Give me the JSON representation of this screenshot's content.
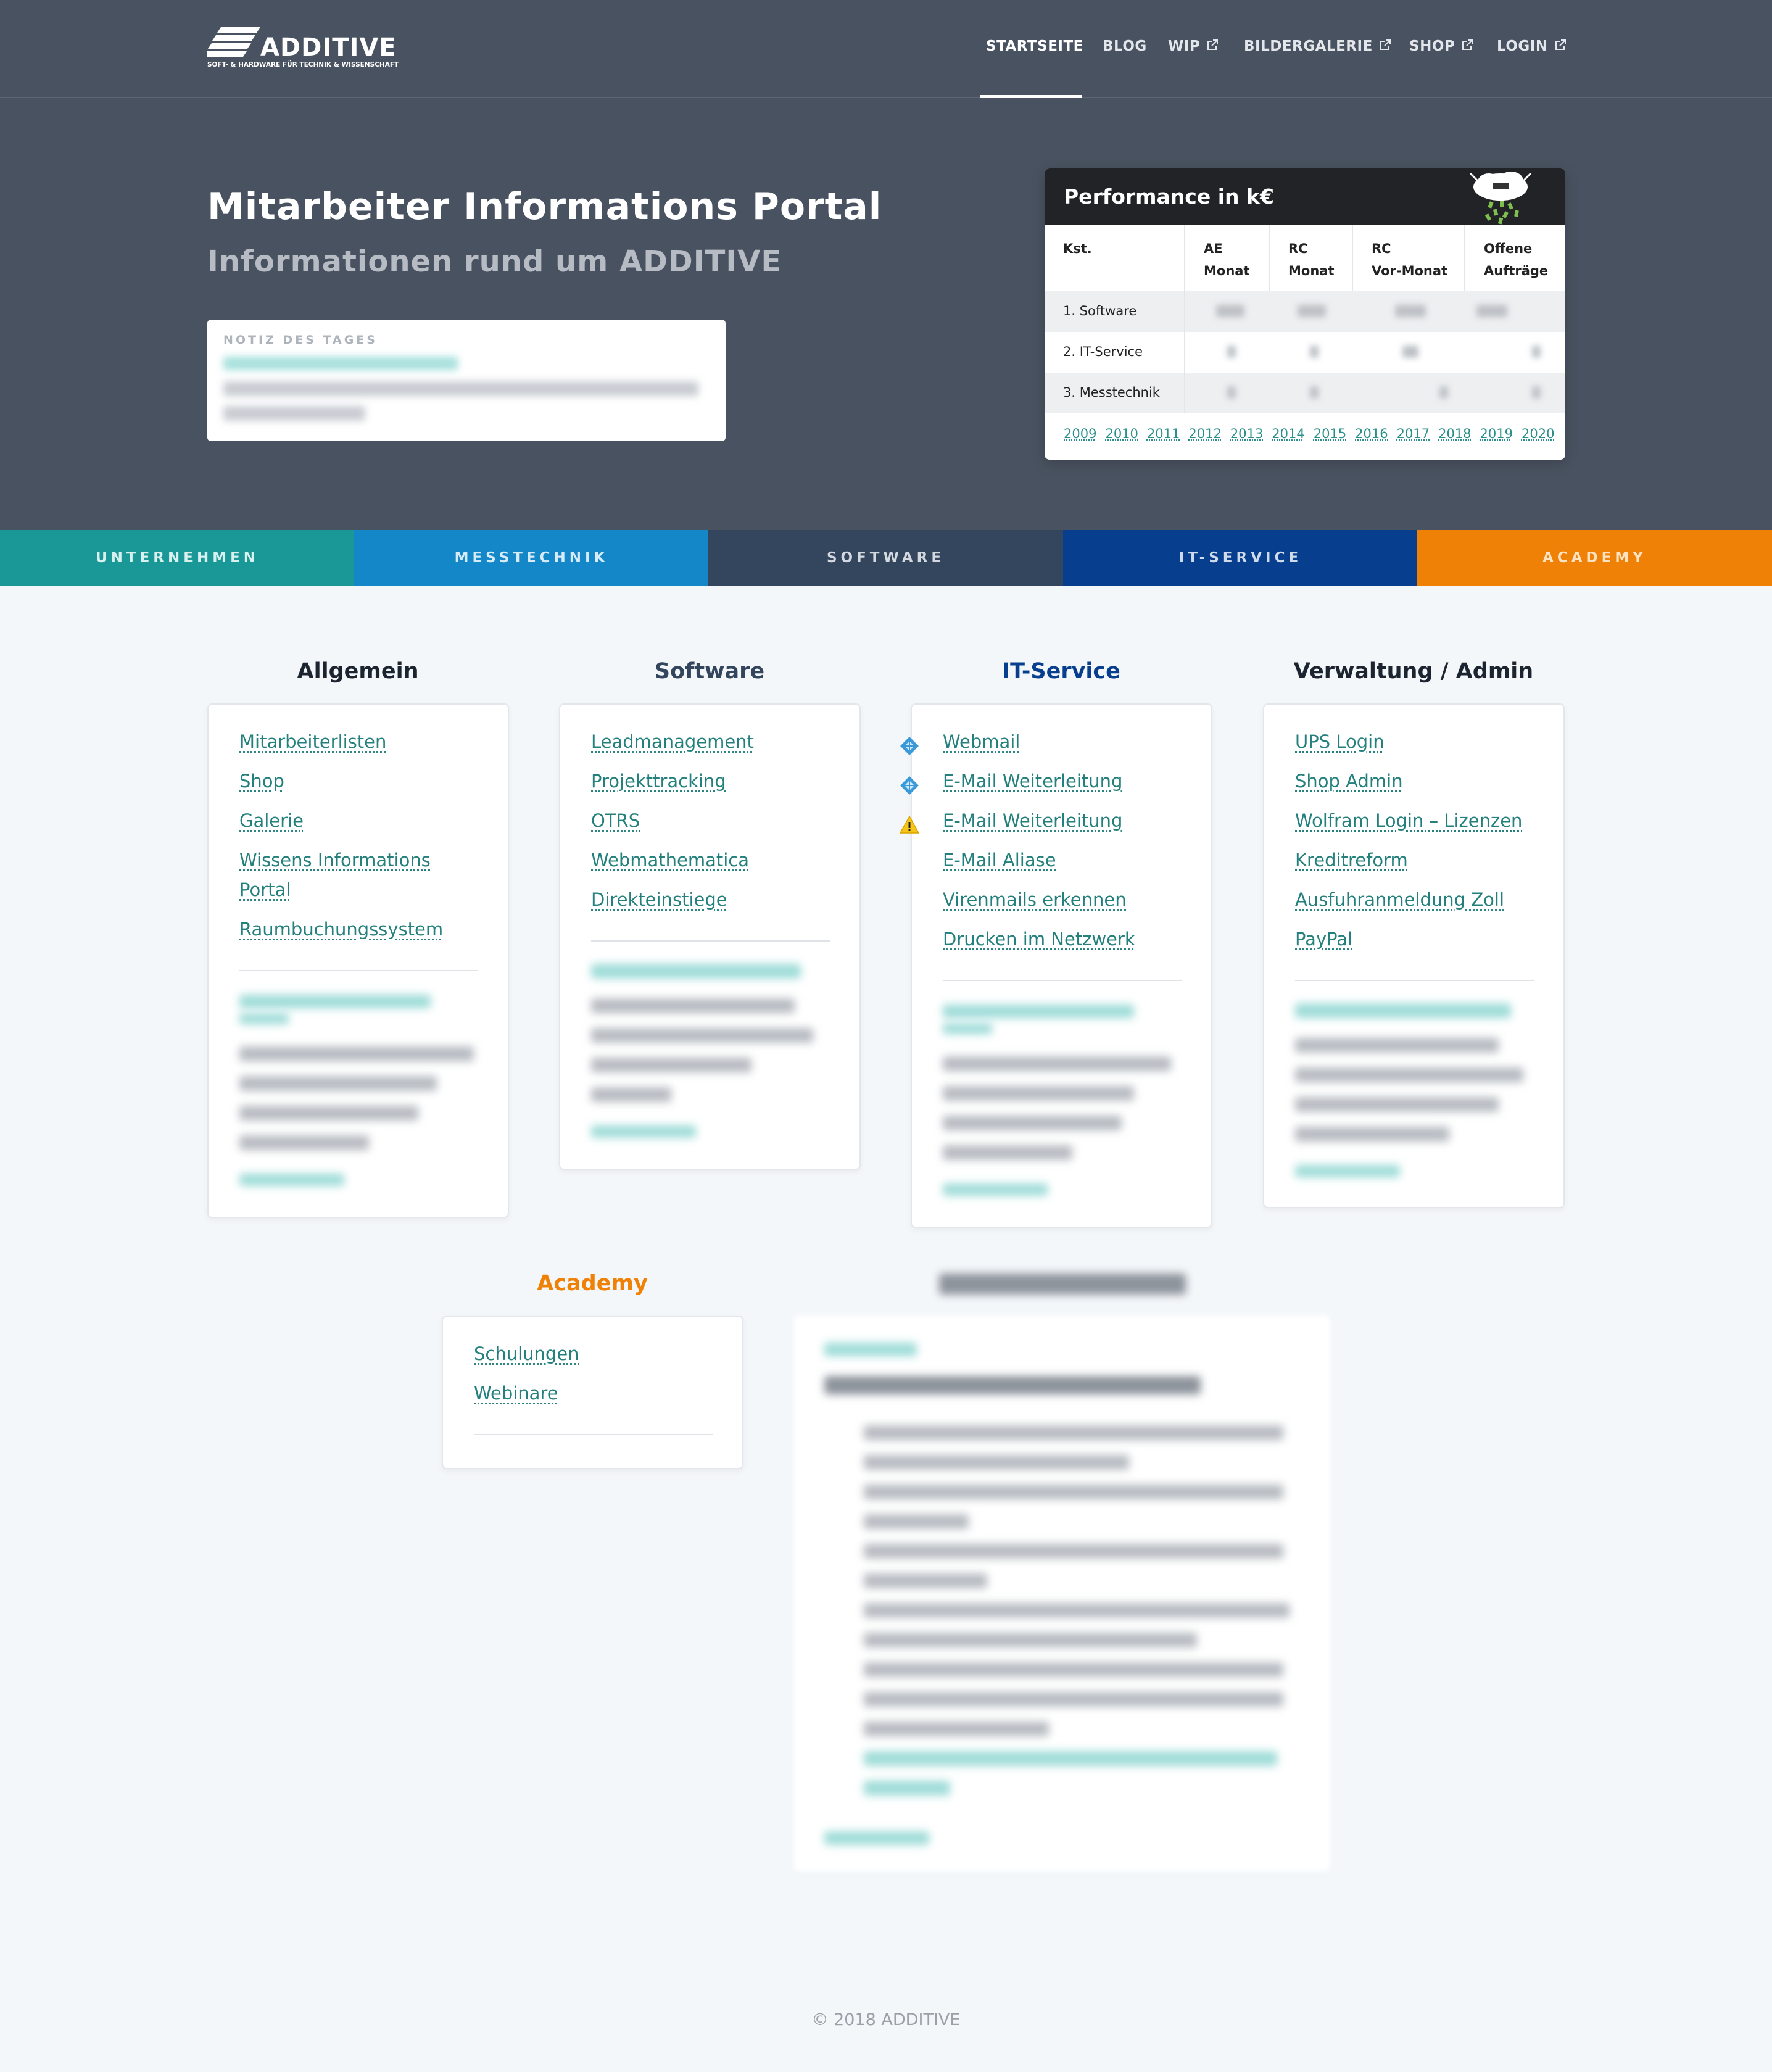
{
  "header": {
    "logo_text": "ADDITIVE",
    "logo_sub": "SOFT- & HARDWARE FÜR TECHNIK & WISSENSCHAFT",
    "nav": [
      {
        "label": "STARTSEITE",
        "external": false,
        "active": true
      },
      {
        "label": "BLOG",
        "external": false,
        "active": false
      },
      {
        "label": "WIP",
        "external": true,
        "active": false
      },
      {
        "label": "BILDERGALERIE",
        "external": true,
        "active": false
      },
      {
        "label": "SHOP",
        "external": true,
        "active": false
      },
      {
        "label": "LOGIN",
        "external": true,
        "active": false
      }
    ]
  },
  "hero": {
    "title": "Mitarbeiter Informations Portal",
    "subtitle": "Informationen rund um ADDITIVE",
    "note_heading": "NOTIZ DES TAGES"
  },
  "performance": {
    "title": "Performance in k€",
    "columns": [
      {
        "line1": "Kst.",
        "line2": ""
      },
      {
        "line1": "AE",
        "line2": "Monat"
      },
      {
        "line1": "RC",
        "line2": "Monat"
      },
      {
        "line1": "RC",
        "line2": "Vor-Monat"
      },
      {
        "line1": "Offene",
        "line2": "Aufträge"
      }
    ],
    "rows": [
      "1. Software",
      "2. IT-Service",
      "3. Messtechnik"
    ],
    "years": [
      "2009",
      "2010",
      "2011",
      "2012",
      "2013",
      "2014",
      "2015",
      "2016",
      "2017",
      "2018",
      "2019",
      "2020"
    ]
  },
  "categories": [
    {
      "label": "UNTERNEHMEN",
      "bg": "#1a9797",
      "fg": "#d8f0ee"
    },
    {
      "label": "MESSTECHNIK",
      "bg": "#1487c8",
      "fg": "#d6ebf7"
    },
    {
      "label": "SOFTWARE",
      "bg": "#34465e",
      "fg": "#d4d9e0"
    },
    {
      "label": "IT-SERVICE",
      "bg": "#073f8e",
      "fg": "#cfdaeb"
    },
    {
      "label": "ACADEMY",
      "bg": "#ef8106",
      "fg": "#fde3c4"
    }
  ],
  "sections": {
    "allgemein": {
      "title": "Allgemein",
      "links": [
        "Mitarbeiterlisten",
        "Shop",
        "Galerie",
        "Wissens Informations",
        "Portal",
        "Raumbuchungssystem"
      ]
    },
    "software": {
      "title": "Software",
      "links": [
        "Leadmanagement",
        "Projekttracking",
        "OTRS",
        "Webmathematica",
        "Direkteinstiege"
      ]
    },
    "itservice": {
      "title": "IT-Service",
      "links": [
        "Webmail",
        "E-Mail Weiterleitung",
        "E-Mail Weiterleitung",
        "E-Mail Aliase",
        "Virenmails erkennen",
        "Drucken im Netzwerk"
      ]
    },
    "verwaltung": {
      "title": "Verwaltung / Admin",
      "links": [
        "UPS Login",
        "Shop Admin",
        "Wolfram Login – Lizenzen",
        "Kreditreform",
        "Ausfuhranmeldung Zoll",
        "PayPal"
      ]
    },
    "academy": {
      "title": "Academy",
      "links": [
        "Schulungen",
        "Webinare"
      ]
    }
  },
  "colors": {
    "header_bg": "#495260",
    "link": "#24807c",
    "title_dark": "#1c2430",
    "title_software": "#34465e",
    "title_itservice": "#073f8e",
    "title_academy": "#ef8106"
  },
  "footer": {
    "copyright": "© 2018 ADDITIVE"
  }
}
